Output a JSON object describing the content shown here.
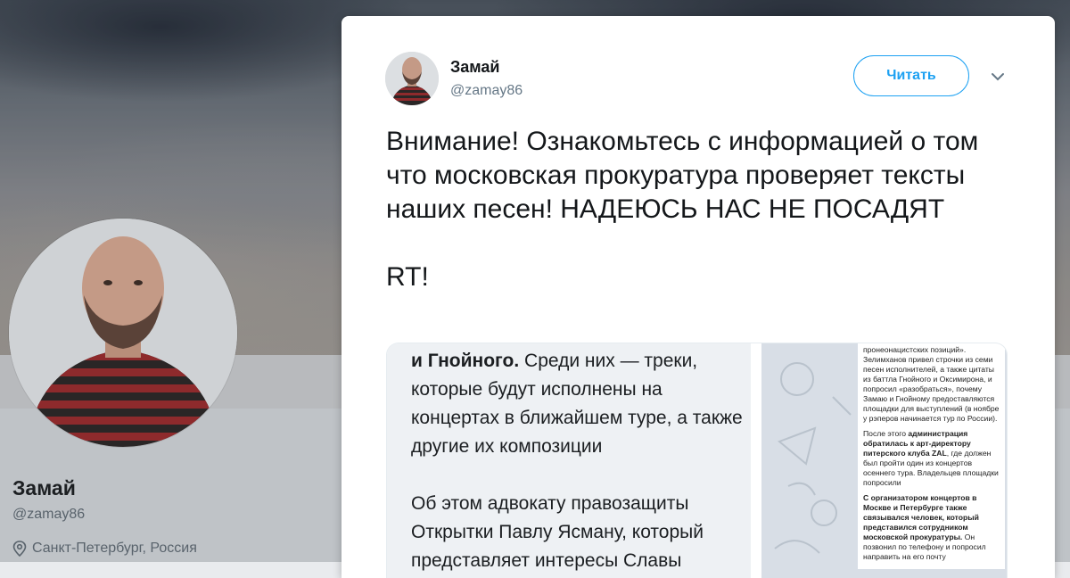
{
  "profile": {
    "name": "Замай",
    "handle": "@zamay86",
    "location": "Санкт-Петербург, Россия"
  },
  "tweet": {
    "author_name": "Замай",
    "author_handle": "@zamay86",
    "follow_label": "Читать",
    "text": "Внимание! Ознакомьтесь с информацией о том что московская прокуратура проверяет тексты наших песен! НАДЕЮСЬ НАС НЕ ПОСАДЯТ\n\nRT!"
  },
  "image": {
    "left_bold": "и Гнойного.",
    "left_text_1": " Среди них — треки, которые будут исполнены на концертах в ближайшем туре, а также другие их композиции\n\nОб этом адвокату правозащиты Открытки Павлу Ясману, который представляет интересы Славы",
    "right_p1": "пронеонацистских позиций». Зелимханов привел строчки из семи песен исполнителей, а также цитаты из баттла Гнойного и Оксимирона, и попросил «разобраться», почему Замаю и Гнойному предоставляются площадки для выступлений (в ноябре у рэперов начинается тур по России).",
    "right_p2_pre": "После этого ",
    "right_p2_bold": "администрация обратилась к арт-директору питерского клуба ZAL",
    "right_p2_post": ", где должен был пройти один из концертов осеннего тура. Владельцев площадки попросили",
    "right_p3_bold": "С организатором концертов в Москве и Петербурге также связывался человек, который представился сотрудником московской прокуратуры.",
    "right_p3_post": " Он позвонил по телефону и попросил направить на его почту"
  },
  "colors": {
    "accent": "#1da1f2",
    "text_primary": "#14171a",
    "text_secondary": "#657786"
  },
  "icons": [
    "chevron-down-icon",
    "location-pin-icon"
  ]
}
